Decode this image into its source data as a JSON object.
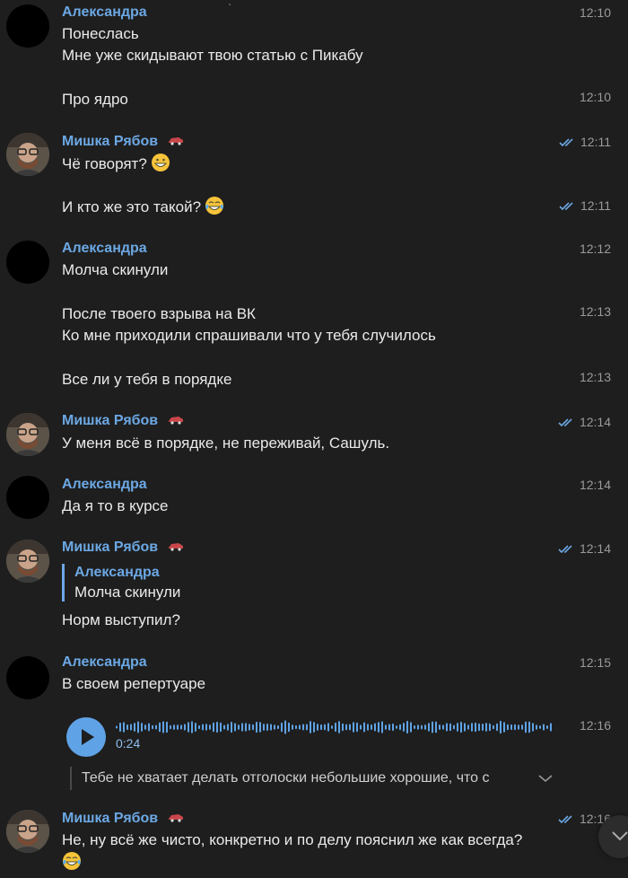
{
  "messages": {
    "m1": {
      "sender": "Александра",
      "lines": [
        "Понеслась",
        "Мне уже скидывают твою статью с Пикабу"
      ],
      "time": "12:10"
    },
    "m2": {
      "text": "Про ядро",
      "time": "12:10"
    },
    "m3": {
      "sender": "Мишка Рябов",
      "text": "Чё говорят?",
      "time": "12:11"
    },
    "m4": {
      "text": "И кто же это такой?",
      "time": "12:11"
    },
    "m5": {
      "sender": "Александра",
      "text": "Молча скинули",
      "time": "12:12"
    },
    "m6": {
      "lines": [
        "После твоего взрыва на ВК",
        "Ко мне приходили спрашивали что у тебя случилось"
      ],
      "time": "12:13"
    },
    "m7": {
      "text": "Все ли у тебя в порядке",
      "time": "12:13"
    },
    "m8": {
      "sender": "Мишка Рябов",
      "text": "У меня всё в порядке, не переживай, Сашуль.",
      "time": "12:14"
    },
    "m9": {
      "sender": "Александра",
      "text": "Да я то в курсе",
      "time": "12:14"
    },
    "m10": {
      "sender": "Мишка Рябов",
      "reply_name": "Александра",
      "reply_text": "Молча скинули",
      "text": "Норм выступил?",
      "time": "12:14"
    },
    "m11": {
      "sender": "Александра",
      "text": "В своем репертуаре",
      "time": "12:15"
    },
    "m12": {
      "voice_duration": "0:24",
      "transcript": "Тебе не хватает делать отголоски небольшие хорошие, что с",
      "time": "12:16"
    },
    "m13": {
      "sender": "Мишка Рябов",
      "text": "Не, ну всё же чисто, конкретно и по делу пояснил же как всегда?",
      "time": "12:16"
    }
  },
  "icons": {
    "read_ticks": "double-check-icon",
    "name_badge": "red-car-icon",
    "play": "play-icon",
    "expand": "chevron-down-icon",
    "scroll_down": "chevron-down-icon"
  },
  "colors": {
    "background": "#1e1e1e",
    "name": "#6ca8e4",
    "ticks": "#6ca8e4",
    "time": "#9a9a9a",
    "play_button": "#5fa3e6"
  }
}
